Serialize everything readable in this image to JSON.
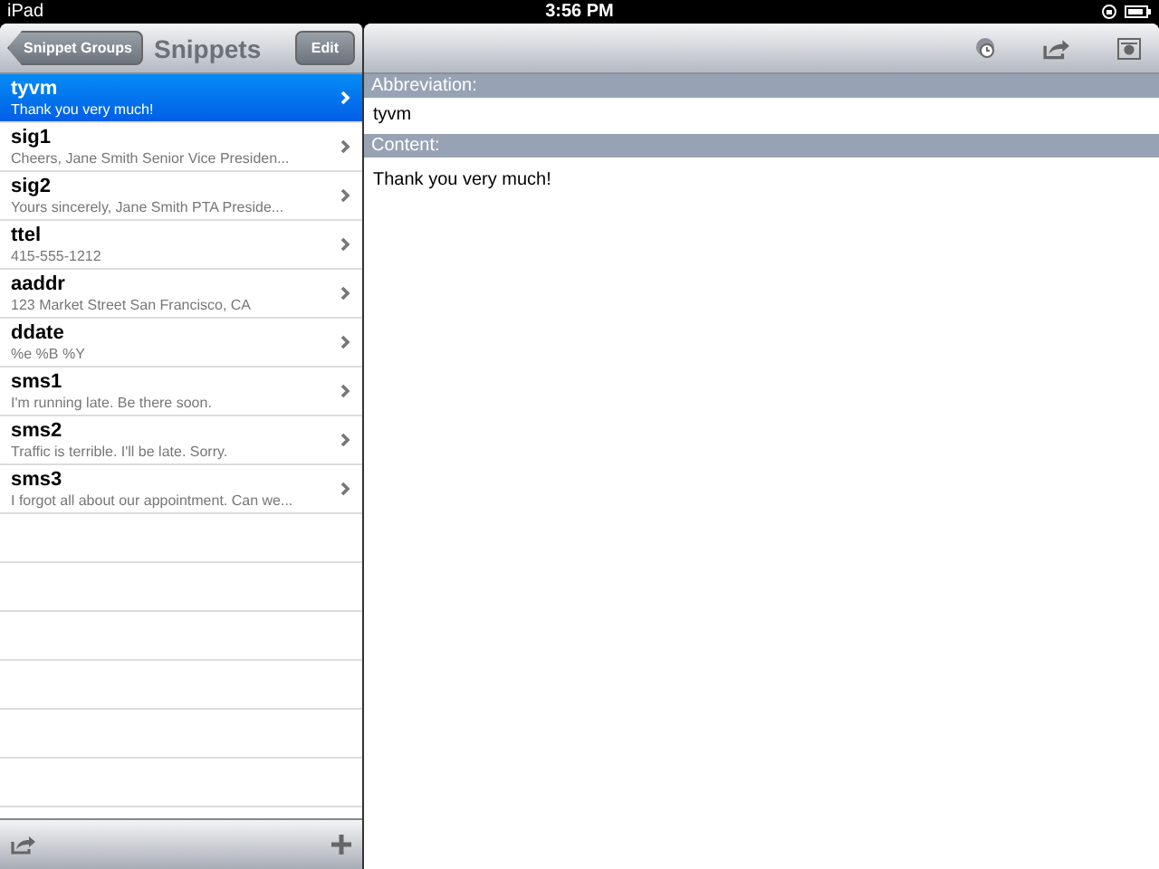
{
  "status_bar": {
    "device": "iPad",
    "time": "3:56 PM"
  },
  "master": {
    "back_button": "Snippet Groups",
    "title": "Snippets",
    "edit_button": "Edit",
    "snippets": [
      {
        "abbreviation": "tyvm",
        "preview": "Thank you very much!",
        "selected": true
      },
      {
        "abbreviation": "sig1",
        "preview": "Cheers,  Jane Smith Senior Vice Presiden...",
        "selected": false
      },
      {
        "abbreviation": "sig2",
        "preview": "Yours sincerely,  Jane Smith PTA Preside...",
        "selected": false
      },
      {
        "abbreviation": "ttel",
        "preview": "415-555-1212",
        "selected": false
      },
      {
        "abbreviation": "aaddr",
        "preview": "123 Market Street San Francisco, CA",
        "selected": false
      },
      {
        "abbreviation": "ddate",
        "preview": "%e %B %Y",
        "selected": false
      },
      {
        "abbreviation": "sms1",
        "preview": "I'm running late. Be there soon.",
        "selected": false
      },
      {
        "abbreviation": "sms2",
        "preview": "Traffic is terrible. I'll be late. Sorry.",
        "selected": false
      },
      {
        "abbreviation": "sms3",
        "preview": "I forgot all about our appointment. Can we...",
        "selected": false
      }
    ]
  },
  "detail": {
    "abbreviation_label": "Abbreviation:",
    "abbreviation": "tyvm",
    "content_label": "Content:",
    "content": "Thank you very much!"
  }
}
